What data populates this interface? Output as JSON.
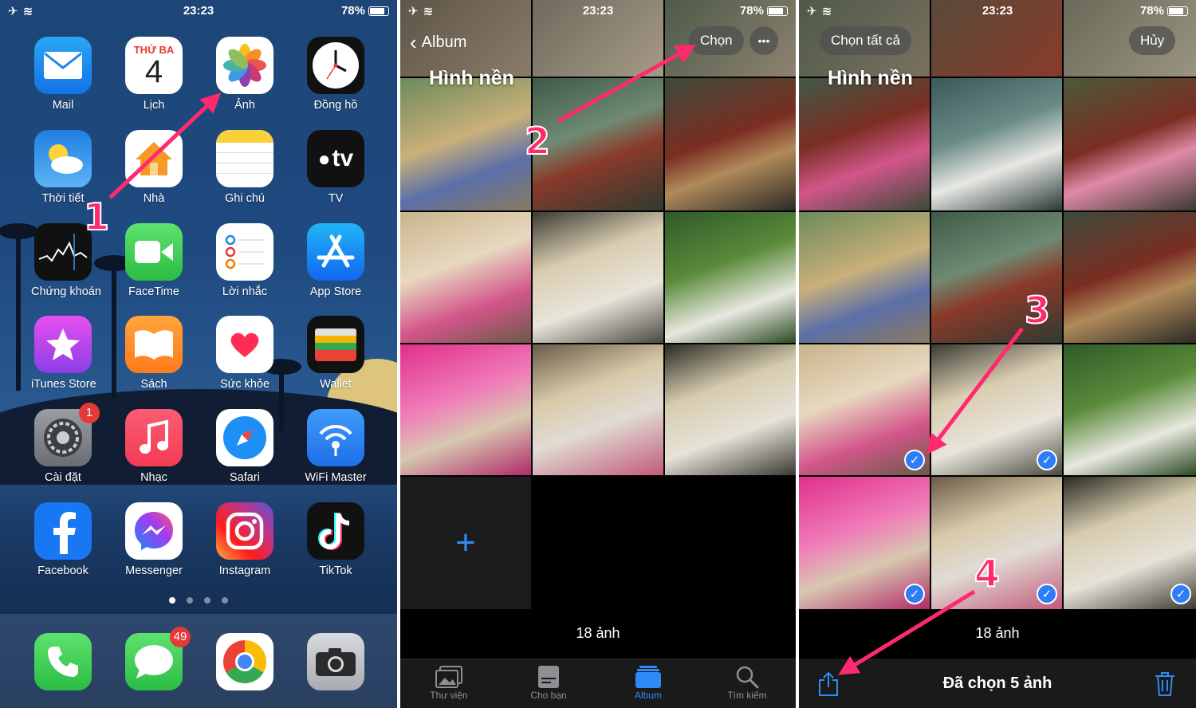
{
  "status": {
    "time": "23:23",
    "battery": "78%",
    "left": "✈ ≋"
  },
  "home": {
    "apps": [
      {
        "label": "Mail",
        "icon": "mail-icon"
      },
      {
        "label": "Lịch",
        "icon": "calendar-icon",
        "day": "THỨ BA",
        "date": "4"
      },
      {
        "label": "Ảnh",
        "icon": "photos-icon"
      },
      {
        "label": "Đồng hồ",
        "icon": "clock-icon"
      },
      {
        "label": "Thời tiết",
        "icon": "weather-icon"
      },
      {
        "label": "Nhà",
        "icon": "home-icon"
      },
      {
        "label": "Ghi chú",
        "icon": "notes-icon"
      },
      {
        "label": "TV",
        "icon": "tv-icon",
        "text": "tv"
      },
      {
        "label": "Chứng khoán",
        "icon": "stocks-icon"
      },
      {
        "label": "FaceTime",
        "icon": "facetime-icon"
      },
      {
        "label": "Lời nhắc",
        "icon": "reminders-icon"
      },
      {
        "label": "App Store",
        "icon": "appstore-icon"
      },
      {
        "label": "iTunes Store",
        "icon": "itunes-icon"
      },
      {
        "label": "Sách",
        "icon": "books-icon"
      },
      {
        "label": "Sức khỏe",
        "icon": "health-icon"
      },
      {
        "label": "Wallet",
        "icon": "wallet-icon"
      },
      {
        "label": "Cài đặt",
        "icon": "settings-icon",
        "badge": "1"
      },
      {
        "label": "Nhạc",
        "icon": "music-icon"
      },
      {
        "label": "Safari",
        "icon": "safari-icon"
      },
      {
        "label": "WiFi Master",
        "icon": "wifi-master-icon"
      },
      {
        "label": "Facebook",
        "icon": "facebook-icon"
      },
      {
        "label": "Messenger",
        "icon": "messenger-icon"
      },
      {
        "label": "Instagram",
        "icon": "instagram-icon"
      },
      {
        "label": "TikTok",
        "icon": "tiktok-icon"
      }
    ],
    "dock": [
      {
        "icon": "phone-icon"
      },
      {
        "icon": "messages-icon",
        "badge": "49"
      },
      {
        "icon": "chrome-icon"
      },
      {
        "icon": "camera-icon"
      }
    ]
  },
  "album": {
    "back_label": "Album",
    "title": "Hình nền",
    "select_label": "Chọn",
    "more_label": "•••",
    "count": "18 ảnh",
    "add_label": "+",
    "tabs": [
      {
        "label": "Thư viện",
        "icon": "library-icon"
      },
      {
        "label": "Cho bạn",
        "icon": "for-you-icon"
      },
      {
        "label": "Album",
        "icon": "albums-icon",
        "active": true
      },
      {
        "label": "Tìm kiếm",
        "icon": "search-icon"
      }
    ]
  },
  "select": {
    "select_all_label": "Chọn tất cả",
    "title": "Hình nền",
    "cancel_label": "Hủy",
    "count": "18 ảnh",
    "selected_label": "Đã chọn 5 ảnh",
    "checkmark": "✓"
  },
  "steps": [
    "1",
    "2",
    "3",
    "4"
  ],
  "colors": {
    "accent": "#2f8af5",
    "arrow": "#ff2a6d",
    "badge": "#e53935"
  }
}
